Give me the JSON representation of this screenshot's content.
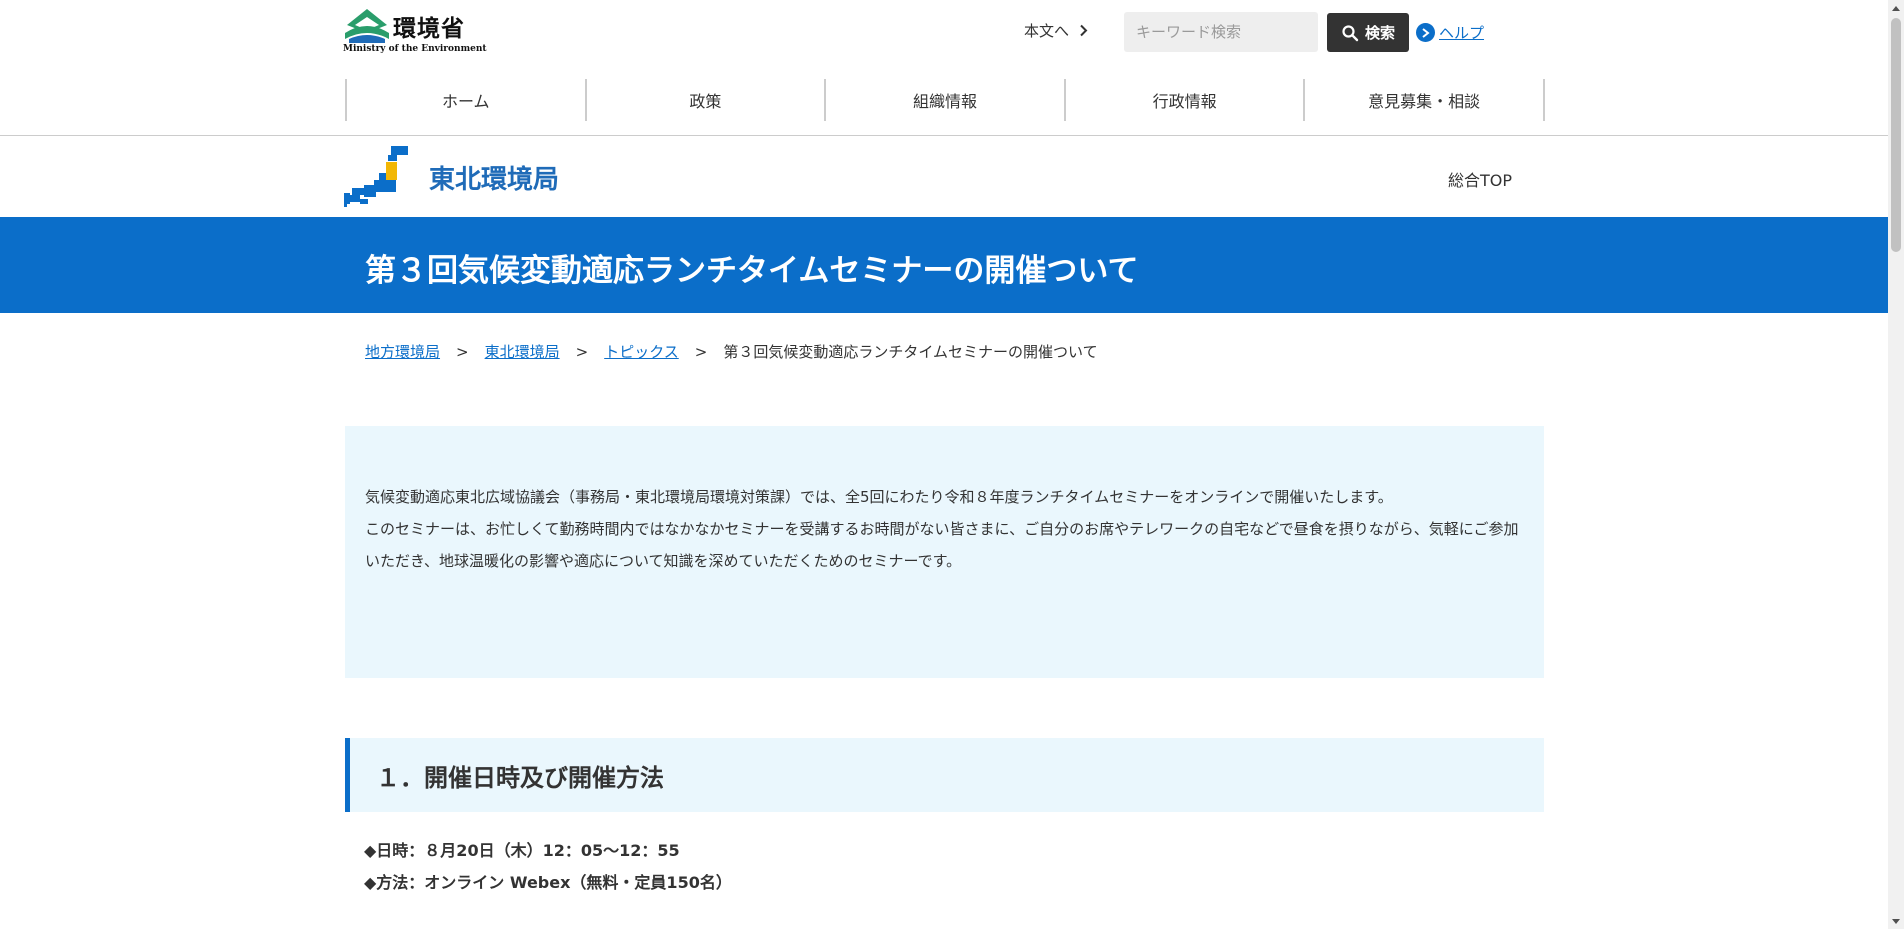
{
  "colors": {
    "brand_blue": "#0b6ec9",
    "bureau_blue": "#1f6bb8",
    "logo_green": "#2a9d6b",
    "light_blue_bg": "#eaf7fd",
    "dark_button": "#333333"
  },
  "header": {
    "logo_text": "環境省",
    "logo_subtext": "Ministry of the Environment",
    "skip_link": "本文へ",
    "search_placeholder": "キーワード検索",
    "search_button": "検索",
    "help_link": "ヘルプ",
    "nav": [
      {
        "label": "ホーム"
      },
      {
        "label": "政策"
      },
      {
        "label": "組織情報"
      },
      {
        "label": "行政情報"
      },
      {
        "label": "意見募集・相談"
      }
    ]
  },
  "bureau": {
    "name": "東北環境局",
    "top_link": "総合TOP"
  },
  "page": {
    "title": "第３回気候変動適応ランチタイムセミナーの開催ついて"
  },
  "breadcrumb": {
    "items": [
      {
        "label": "地方環境局"
      },
      {
        "label": "東北環境局"
      },
      {
        "label": "トピックス"
      }
    ],
    "current": "第３回気候変動適応ランチタイムセミナーの開催ついて",
    "separator": ">"
  },
  "intro": {
    "line1": "気候変動適応東北広域協議会（事務局・東北環境局環境対策課）では、全5回にわたり令和８年度ランチタイムセミナーをオンラインで開催いたします。",
    "line2": "このセミナーは、お忙しくて勤務時間内ではなかなかセミナーを受講するお時間がない皆さまに、ご自分のお席やテレワークの自宅などで昼食を摂りながら、気軽にご参加いただき、地球温暖化の影響や適応について知識を深めていただくためのセミナーです。"
  },
  "section1": {
    "heading": "１．開催日時及び開催方法",
    "datetime": "◆日時：８月20日（木）12：05～12：55",
    "method": "◆方法：オンライン Webex（無料・定員150名）"
  },
  "icons": {
    "logo": "moe-logo-icon",
    "skip": "chevron-right-icon",
    "search": "search-icon",
    "help": "help-arrow-icon",
    "bureau": "japan-map-icon"
  }
}
